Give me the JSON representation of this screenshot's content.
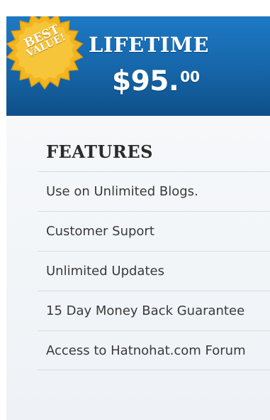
{
  "colors": {
    "header_blue": "#1665a8",
    "badge_gold": "#f2b51f",
    "body_background": "#eef2f6",
    "text_dark": "#3a3a3a"
  },
  "badge": {
    "line1": "BEST",
    "line2": "VALUE!",
    "icon": "starburst-badge"
  },
  "plan": {
    "name": "LIFETIME",
    "price_main": "$95.",
    "price_cents": "00"
  },
  "features": {
    "title": "FEATURES",
    "items": [
      "Use on Unlimited Blogs.",
      "Customer Suport",
      "Unlimited Updates",
      "15 Day Money Back Guarantee",
      "Access to Hatnohat.com Forum"
    ]
  }
}
